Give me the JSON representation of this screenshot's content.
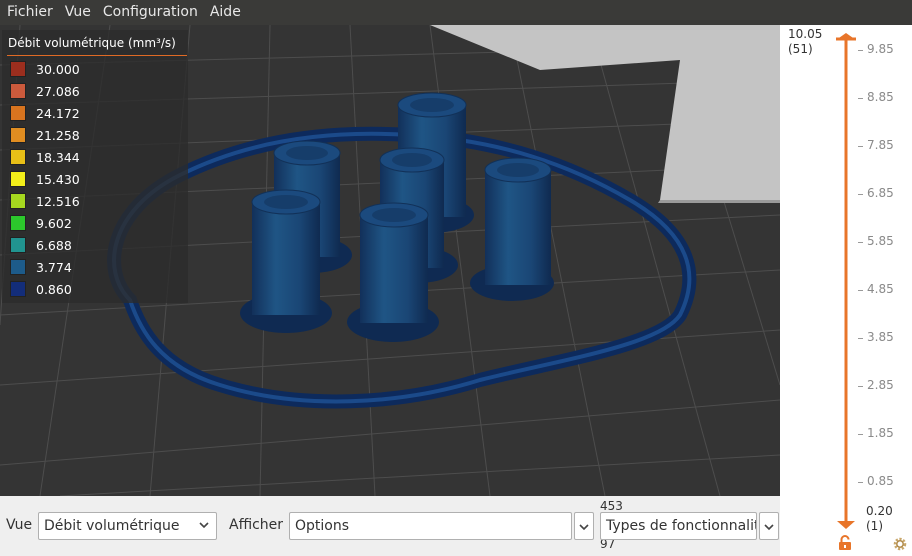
{
  "menu": [
    "Fichier",
    "Vue",
    "Configuration",
    "Aide"
  ],
  "legend": {
    "title": "Débit volumétrique (mm³/s)",
    "items": [
      {
        "value": "30.000",
        "color": "#9c2e1e"
      },
      {
        "value": "27.086",
        "color": "#cc5a3c"
      },
      {
        "value": "24.172",
        "color": "#d8741f"
      },
      {
        "value": "21.258",
        "color": "#e08d21"
      },
      {
        "value": "18.344",
        "color": "#e8bf17"
      },
      {
        "value": "15.430",
        "color": "#f2ee1a"
      },
      {
        "value": "12.516",
        "color": "#a6d81f"
      },
      {
        "value": "9.602",
        "color": "#2cc82c"
      },
      {
        "value": "6.688",
        "color": "#219490"
      },
      {
        "value": "3.774",
        "color": "#1d5b8a"
      },
      {
        "value": "0.860",
        "color": "#132d7a"
      }
    ]
  },
  "slider": {
    "top_value": "10.05",
    "top_layer": "(51)",
    "bottom_value": "0.20",
    "bottom_layer": "(1)",
    "ticks": [
      "9.85",
      "8.85",
      "7.85",
      "6.85",
      "5.85",
      "4.85",
      "3.85",
      "2.85",
      "1.85",
      "0.85"
    ],
    "accent": "#e8752a"
  },
  "bottom": {
    "view_label": "Vue",
    "view_value": "Débit volumétrique",
    "show_label": "Afficher",
    "options_value": "Options",
    "stat_top": "453",
    "stat_bottom": "97",
    "feature_value": "Types de fonctionnalit"
  }
}
